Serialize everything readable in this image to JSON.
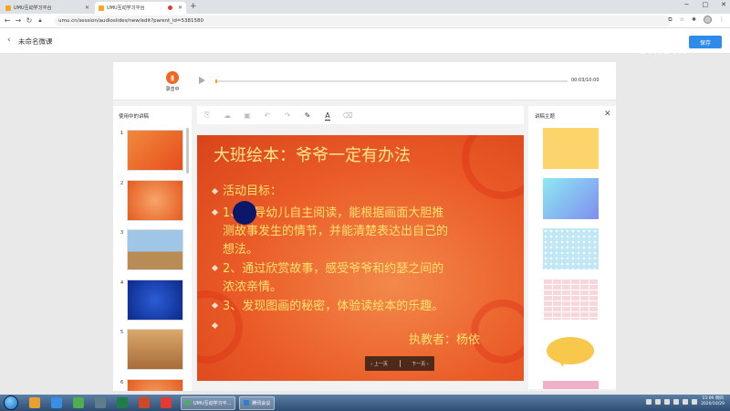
{
  "browser": {
    "tabs": [
      {
        "title": "UMU互动学习平台",
        "active": false
      },
      {
        "title": "UMU互动学习平台",
        "active": true
      }
    ],
    "new_tab": "+",
    "url": "umu.cn/session/audioslides/new/edit?parent_id=5381580",
    "window_controls": [
      "−",
      "□",
      "✕"
    ]
  },
  "app": {
    "back_icon": "‹",
    "course_title": "未命名微课",
    "save_label": "保存",
    "watermark": "bilibili"
  },
  "player": {
    "rec_label": "录音中",
    "time": "00:03/10:00",
    "progress_fraction": 0.005
  },
  "thumbnails": {
    "title": "使用中的讲稿",
    "items": [
      {
        "num": "1",
        "style": "th-or"
      },
      {
        "num": "2",
        "style": "th-or2"
      },
      {
        "num": "3",
        "style": "th-pic"
      },
      {
        "num": "4",
        "style": "th-blue"
      },
      {
        "num": "5",
        "style": "th-room"
      },
      {
        "num": "6",
        "style": "th-or2"
      }
    ]
  },
  "toolbar": {
    "icons": [
      "copy-icon",
      "upload-icon",
      "video-icon",
      "undo-icon",
      "redo-icon",
      "pen-icon",
      "text-color-icon",
      "eraser-icon"
    ]
  },
  "slide": {
    "title": "大班绘本：爷爷一定有办法",
    "lines": [
      "活动目标：",
      "1、引导幼儿自主阅读，能根据画面大胆推",
      "测故事发生的情节，并能清楚表达出自己的",
      "想法。",
      "2、通过欣赏故事，感受爷爷和约瑟之间的",
      "浓浓亲情。",
      "3、发现图画的秘密，体验读绘本的乐趣。"
    ],
    "author": "执教者：杨依",
    "prev_label": "上一页",
    "next_label": "下一页"
  },
  "themes": {
    "title": "讲稿主题",
    "close_icon": "✕",
    "swatches": [
      "#fdd36b",
      "linear-gradient(135deg,#8ee9f2,#7f8df0)",
      "#bfe7f6",
      "#f8d7dc",
      "bubble",
      "#f2b0c8"
    ]
  },
  "taskbar": {
    "tasks": [
      {
        "label": "UMU互动学习平..."
      },
      {
        "label": "腾讯会议"
      }
    ],
    "clock_time": "15:09 周四",
    "clock_date": "2020/10/29"
  }
}
